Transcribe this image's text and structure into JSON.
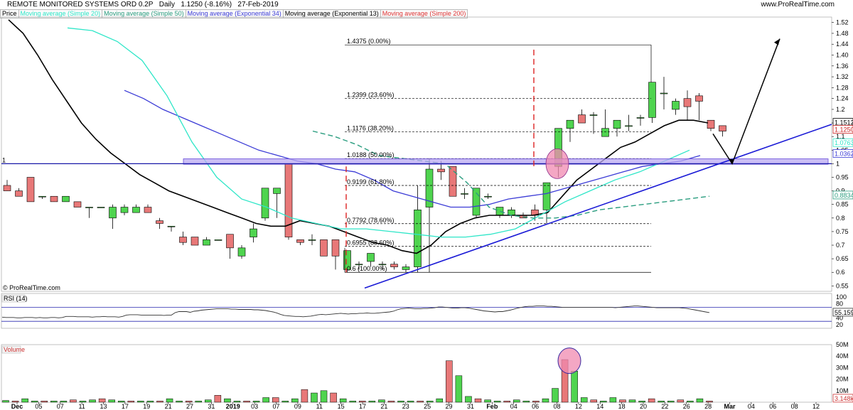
{
  "header": {
    "title": "REMOTE MONITORED SYSTEMS ORD 0.2P",
    "period": "Daily",
    "quote": "1.1250 (-8.16%)",
    "date": "27-Feb-2019",
    "brand": "www.ProRealTime.com",
    "watermark": "© ProRealTime.com"
  },
  "legend": [
    {
      "label": "Price",
      "color": "#000000"
    },
    {
      "label": "Moving average (Simple 20)",
      "color": "#2ee6c8"
    },
    {
      "label": "Moving average (Simple 50)",
      "color": "#2a9d7f"
    },
    {
      "label": "Moving average (Exponential 34)",
      "color": "#3b3bd6"
    },
    {
      "label": "Moving average (Exponential 13)",
      "color": "#000000"
    },
    {
      "label": "Moving average (Simple 200)",
      "color": "#dd3333"
    }
  ],
  "chart_data": [
    {
      "type": "candlestick",
      "title": "REMOTE MONITORED SYSTEMS ORD 0.2P",
      "ylim": [
        0.53,
        1.54
      ],
      "y_ticks": [
        1.52,
        1.48,
        1.44,
        1.4,
        1.36,
        1.32,
        1.28,
        1.24,
        1.2,
        1.15,
        1.1,
        1.05,
        1,
        0.95,
        0.9,
        0.85,
        0.8,
        0.75,
        0.7,
        0.65,
        0.6,
        0.55
      ],
      "y_tick_labels": [
        "1.52",
        "1.48",
        "1.44",
        "1.40",
        "1.36",
        "1.32",
        "1.28",
        "1.24",
        "1.2",
        "1.15",
        "1.1",
        "1.05",
        "1",
        "0.95",
        "0.9",
        "0.85",
        "0.8",
        "0.75",
        "0.7",
        "0.65",
        "0.6",
        "0.55"
      ],
      "x_labels": [
        "Dec",
        "05",
        "07",
        "11",
        "13",
        "17",
        "19",
        "21",
        "27",
        "31",
        "2019",
        "03",
        "07",
        "09",
        "11",
        "15",
        "17",
        "21",
        "23",
        "25",
        "29",
        "31",
        "Feb",
        "04",
        "06",
        "08",
        "12",
        "14",
        "18",
        "20",
        "22",
        "26",
        "28",
        "Mar",
        "04",
        "06",
        "08",
        "12"
      ],
      "candles": [
        {
          "o": 0.92,
          "h": 0.94,
          "l": 0.9,
          "c": 0.9
        },
        {
          "o": 0.9,
          "h": 0.91,
          "l": 0.88,
          "c": 0.88
        },
        {
          "o": 0.95,
          "h": 0.95,
          "l": 0.86,
          "c": 0.86
        },
        {
          "o": 0.88,
          "h": 0.88,
          "l": 0.87,
          "c": 0.88
        },
        {
          "o": 0.88,
          "h": 0.88,
          "l": 0.86,
          "c": 0.86
        },
        {
          "o": 0.86,
          "h": 0.88,
          "l": 0.86,
          "c": 0.88
        },
        {
          "o": 0.86,
          "h": 0.86,
          "l": 0.84,
          "c": 0.84
        },
        {
          "o": 0.84,
          "h": 0.84,
          "l": 0.8,
          "c": 0.84
        },
        {
          "o": 0.84,
          "h": 0.84,
          "l": 0.84,
          "c": 0.84
        },
        {
          "o": 0.8,
          "h": 0.85,
          "l": 0.76,
          "c": 0.84
        },
        {
          "o": 0.82,
          "h": 0.85,
          "l": 0.81,
          "c": 0.84
        },
        {
          "o": 0.82,
          "h": 0.85,
          "l": 0.82,
          "c": 0.84
        },
        {
          "o": 0.84,
          "h": 0.85,
          "l": 0.82,
          "c": 0.82
        },
        {
          "o": 0.79,
          "h": 0.8,
          "l": 0.76,
          "c": 0.78
        },
        {
          "o": 0.77,
          "h": 0.77,
          "l": 0.75,
          "c": 0.77
        },
        {
          "o": 0.73,
          "h": 0.75,
          "l": 0.7,
          "c": 0.71
        },
        {
          "o": 0.73,
          "h": 0.73,
          "l": 0.7,
          "c": 0.7
        },
        {
          "o": 0.7,
          "h": 0.73,
          "l": 0.7,
          "c": 0.72
        },
        {
          "o": 0.72,
          "h": 0.72,
          "l": 0.72,
          "c": 0.72
        },
        {
          "o": 0.74,
          "h": 0.74,
          "l": 0.65,
          "c": 0.69
        },
        {
          "o": 0.66,
          "h": 0.7,
          "l": 0.65,
          "c": 0.69
        },
        {
          "o": 0.73,
          "h": 0.78,
          "l": 0.71,
          "c": 0.76
        },
        {
          "o": 0.8,
          "h": 0.91,
          "l": 0.79,
          "c": 0.91
        },
        {
          "o": 0.89,
          "h": 0.91,
          "l": 0.8,
          "c": 0.91
        },
        {
          "o": 1.0,
          "h": 1.0,
          "l": 0.72,
          "c": 0.73
        },
        {
          "o": 0.72,
          "h": 0.72,
          "l": 0.7,
          "c": 0.71
        },
        {
          "o": 0.72,
          "h": 0.74,
          "l": 0.7,
          "c": 0.72
        },
        {
          "o": 0.72,
          "h": 0.72,
          "l": 0.66,
          "c": 0.66
        },
        {
          "o": 0.72,
          "h": 0.72,
          "l": 0.61,
          "c": 0.66
        },
        {
          "o": 0.61,
          "h": 0.68,
          "l": 0.6,
          "c": 0.68
        },
        {
          "o": 0.63,
          "h": 0.64,
          "l": 0.61,
          "c": 0.63
        },
        {
          "o": 0.64,
          "h": 0.67,
          "l": 0.62,
          "c": 0.67
        },
        {
          "o": 0.63,
          "h": 0.64,
          "l": 0.61,
          "c": 0.63
        },
        {
          "o": 0.63,
          "h": 0.64,
          "l": 0.61,
          "c": 0.62
        },
        {
          "o": 0.61,
          "h": 0.63,
          "l": 0.6,
          "c": 0.62
        },
        {
          "o": 0.62,
          "h": 0.92,
          "l": 0.6,
          "c": 0.83
        },
        {
          "o": 0.84,
          "h": 1.02,
          "l": 0.6,
          "c": 0.98
        },
        {
          "o": 0.98,
          "h": 1.01,
          "l": 0.94,
          "c": 0.97
        },
        {
          "o": 0.99,
          "h": 0.99,
          "l": 0.88,
          "c": 0.88
        },
        {
          "o": 0.89,
          "h": 0.91,
          "l": 0.87,
          "c": 0.89
        },
        {
          "o": 0.81,
          "h": 0.91,
          "l": 0.8,
          "c": 0.91
        },
        {
          "o": 0.88,
          "h": 0.89,
          "l": 0.87,
          "c": 0.88
        },
        {
          "o": 0.81,
          "h": 0.84,
          "l": 0.8,
          "c": 0.84
        },
        {
          "o": 0.81,
          "h": 0.84,
          "l": 0.8,
          "c": 0.83
        },
        {
          "o": 0.81,
          "h": 0.82,
          "l": 0.8,
          "c": 0.8
        },
        {
          "o": 0.83,
          "h": 0.85,
          "l": 0.79,
          "c": 0.81
        },
        {
          "o": 0.83,
          "h": 0.93,
          "l": 0.78,
          "c": 0.93
        },
        {
          "o": 0.99,
          "h": 1.13,
          "l": 0.95,
          "c": 1.13
        },
        {
          "o": 1.13,
          "h": 1.16,
          "l": 1.08,
          "c": 1.16
        },
        {
          "o": 1.18,
          "h": 1.2,
          "l": 1.15,
          "c": 1.15
        },
        {
          "o": 1.18,
          "h": 1.19,
          "l": 1.11,
          "c": 1.18
        },
        {
          "o": 1.1,
          "h": 1.2,
          "l": 1.1,
          "c": 1.13
        },
        {
          "o": 1.13,
          "h": 1.16,
          "l": 1.1,
          "c": 1.16
        },
        {
          "o": 1.14,
          "h": 1.18,
          "l": 1.12,
          "c": 1.14
        },
        {
          "o": 1.17,
          "h": 1.18,
          "l": 1.14,
          "c": 1.17
        },
        {
          "o": 1.17,
          "h": 1.3,
          "l": 1.15,
          "c": 1.3
        },
        {
          "o": 1.26,
          "h": 1.32,
          "l": 1.2,
          "c": 1.26
        },
        {
          "o": 1.2,
          "h": 1.24,
          "l": 1.18,
          "c": 1.23
        },
        {
          "o": 1.24,
          "h": 1.27,
          "l": 1.16,
          "c": 1.21
        },
        {
          "o": 1.25,
          "h": 1.26,
          "l": 1.16,
          "c": 1.23
        },
        {
          "o": 1.16,
          "h": 1.16,
          "l": 1.12,
          "c": 1.13
        },
        {
          "o": 1.14,
          "h": 1.14,
          "l": 1.1,
          "c": 1.12
        }
      ],
      "moving_averages": {
        "Exponential 13": [
          1.53,
          1.48,
          1.4,
          1.31,
          1.23,
          1.15,
          1.09,
          1.04,
          1.0,
          0.96,
          0.93,
          0.9,
          0.88,
          0.86,
          0.84,
          0.82,
          0.8,
          0.78,
          0.77,
          0.77,
          0.79,
          0.78,
          0.77,
          0.75,
          0.73,
          0.71,
          0.7,
          0.68,
          0.67,
          0.7,
          0.75,
          0.78,
          0.8,
          0.81,
          0.81,
          0.81,
          0.81,
          0.82,
          0.88,
          0.94,
          0.98,
          1.02,
          1.06,
          1.08,
          1.11,
          1.14,
          1.16,
          1.16,
          1.15
        ],
        "Exponential 34": [
          1.27,
          1.24,
          1.2,
          1.17,
          1.14,
          1.11,
          1.08,
          1.05,
          1.03,
          1.01,
          1.0,
          0.98,
          0.97,
          0.94,
          0.9,
          0.88,
          0.86,
          0.84,
          0.84,
          0.85,
          0.87,
          0.88,
          0.89,
          0.91,
          0.93,
          0.95,
          0.97,
          0.99,
          1.0,
          1.01,
          1.03
        ],
        "Simple 20": [
          1.5,
          1.49,
          1.45,
          1.38,
          1.25,
          1.08,
          0.95,
          0.87,
          0.84,
          0.8,
          0.78,
          0.76,
          0.76,
          0.75,
          0.74,
          0.73,
          0.73,
          0.74,
          0.76,
          0.81,
          0.86,
          0.9,
          0.94,
          0.97,
          1.01,
          1.05
        ],
        "Simple 50": [
          1.12,
          1.1,
          1.07,
          1.03,
          1.02,
          1.01,
          1.0,
          0.93,
          0.84,
          0.81,
          0.8,
          0.8,
          0.81,
          0.83,
          0.84,
          0.85,
          0.86,
          0.87,
          0.88
        ]
      },
      "fibonacci": [
        {
          "label": "1.4375 (0.00%)",
          "value": 1.4375
        },
        {
          "label": "1.2399 (23.60%)",
          "value": 1.2399
        },
        {
          "label": "1.1176 (38.20%)",
          "value": 1.1176
        },
        {
          "label": "1.0188 (50.00%)",
          "value": 1.0188
        },
        {
          "label": "0.9199 (61.80%)",
          "value": 0.9199
        },
        {
          "label": "0.7792 (78.60%)",
          "value": 0.7792
        },
        {
          "label": "0.6955 (88.60%)",
          "value": 0.6955
        },
        {
          "label": "0.6 (100.00%)",
          "value": 0.6
        }
      ],
      "horizontal_line": {
        "value": 1.0,
        "label": "1"
      },
      "price_markers": [
        {
          "label": "1.1512",
          "value": 1.1512,
          "color": "#000000"
        },
        {
          "label": "1.1250",
          "value": 1.125,
          "color": "#cc2222"
        },
        {
          "label": "1.0763",
          "value": 1.0763,
          "color": "#2ee6c8"
        },
        {
          "label": "1.0362",
          "value": 1.0362,
          "color": "#3b3bd6"
        },
        {
          "label": "0.8834",
          "value": 0.8834,
          "color": "#2a9d7f"
        }
      ]
    },
    {
      "type": "line",
      "title": "RSI (14)",
      "ylim": [
        10,
        110
      ],
      "y_ticks": [
        100,
        80,
        60,
        40,
        20
      ],
      "y_tick_labels": [
        "100",
        "80",
        "60",
        "40",
        "20"
      ],
      "levels": [
        70,
        30
      ],
      "values": [
        42,
        41,
        41,
        41,
        40,
        40,
        41,
        41,
        41,
        40,
        41,
        40,
        40,
        41,
        41,
        40,
        41,
        44,
        44,
        44,
        43,
        43,
        43,
        43,
        42,
        43,
        43,
        44,
        43,
        43,
        43,
        42,
        44,
        48,
        49,
        49,
        49,
        48,
        48,
        48,
        48,
        48,
        48,
        47,
        48,
        48,
        55,
        58,
        58,
        58,
        56,
        59,
        60,
        62,
        63,
        64,
        65,
        66,
        66,
        66,
        66,
        65,
        65,
        64,
        64,
        64,
        64,
        63,
        63,
        62,
        61,
        59,
        57,
        54,
        50,
        47,
        46,
        45,
        44,
        44,
        43,
        44,
        45,
        47,
        49,
        50,
        49,
        50,
        51,
        52,
        53,
        52,
        51,
        52,
        52,
        53,
        53,
        54,
        53,
        53,
        54,
        55,
        56,
        57,
        59,
        63,
        66,
        67,
        68,
        67,
        66,
        66,
        67,
        67,
        68,
        69,
        71,
        71,
        70,
        69,
        68,
        68,
        69,
        69,
        68,
        66,
        64,
        62,
        60,
        59,
        58,
        57,
        58,
        58,
        60,
        62,
        65,
        68,
        70,
        72,
        73,
        73,
        74,
        74,
        74,
        73,
        73,
        72,
        71,
        70,
        70,
        70,
        70,
        70,
        70,
        70,
        70,
        70,
        70,
        70,
        70,
        70,
        70,
        69,
        70,
        71,
        72,
        73,
        74,
        74,
        73,
        72,
        71,
        70,
        69,
        69,
        69,
        69,
        69,
        69,
        69,
        68,
        67,
        65,
        63,
        61,
        59,
        57,
        55
      ],
      "last_value_label": "55.159"
    },
    {
      "type": "bar",
      "title": "Volume",
      "ylim": [
        0,
        50
      ],
      "y_ticks": [
        50,
        40,
        30,
        20,
        10
      ],
      "y_tick_labels": [
        "50M",
        "40M",
        "30M",
        "20M",
        "10M"
      ],
      "values": [
        1.5,
        1,
        3,
        1,
        1,
        1,
        1,
        2,
        1,
        2,
        3,
        2,
        1,
        1,
        1,
        1,
        1,
        3,
        1,
        1,
        1,
        2,
        6,
        3,
        1,
        1,
        1,
        4,
        4,
        1,
        3,
        11,
        8,
        10,
        8,
        3,
        1,
        1,
        1,
        2,
        1,
        1,
        1,
        1,
        1,
        3,
        36,
        23,
        5,
        3,
        2,
        1,
        1,
        2,
        1,
        1,
        3,
        12,
        37,
        27,
        4,
        2,
        1,
        4,
        2,
        2,
        1,
        3,
        1,
        1,
        2,
        1,
        3,
        1
      ],
      "last_value_label": "3.148k"
    }
  ],
  "annotations": {
    "arrow": "black arrow (projected bounce from trendline)",
    "pink_circles": [
      "price breakout candle",
      "volume spike"
    ],
    "dashed_red_verticals": [
      "dashed marker",
      "dashed marker"
    ]
  }
}
